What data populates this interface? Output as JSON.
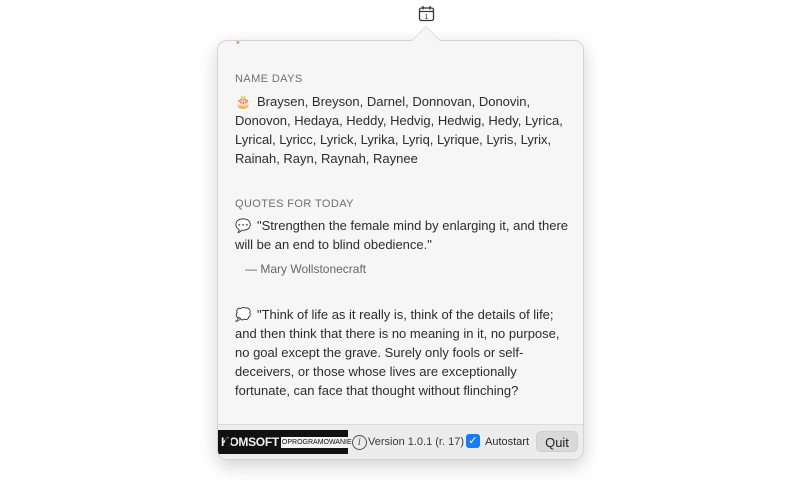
{
  "menubar": {
    "icon": "calendar-icon",
    "date_digit": "1"
  },
  "stub_text": "•",
  "name_days": {
    "title": "NAME DAYS",
    "emoji": "🎂",
    "names": "Braysen, Breyson, Darnel, Donnovan, Donovin, Donovon, Hedaya, Heddy, Hedvig, Hedwig, Hedy, Lyrica, Lyrical, Lyricc, Lyrick, Lyrika, Lyriq, Lyrique, Lyris, Lyrix, Rainah, Rayn, Raynah, Raynee"
  },
  "quotes": {
    "title": "QUOTES FOR TODAY",
    "items": [
      {
        "emoji": "💬",
        "text": "\"Strengthen the female mind by enlarging it, and there will be an end to blind obedience.\"",
        "author": "— Mary Wollstonecraft"
      },
      {
        "emoji": "💭",
        "text": "\"Think of life as it really is, think of the details of life; and then think that there is no meaning in it, no purpose, no goal except the grave. Surely only fools or self-deceivers, or those whose lives are exceptionally fortunate, can face that thought without flinching?"
      }
    ]
  },
  "footer": {
    "logo_main": "KOMSOFT",
    "logo_sub": "OPROGRAMOWANIE",
    "info_glyph": "i",
    "version": "Version 1.0.1 (r. 17)",
    "autostart_label": "Autostart",
    "autostart_checked": true,
    "check_glyph": "✓",
    "quit_label": "Quit",
    "accent_color": "#1a7cf4"
  }
}
